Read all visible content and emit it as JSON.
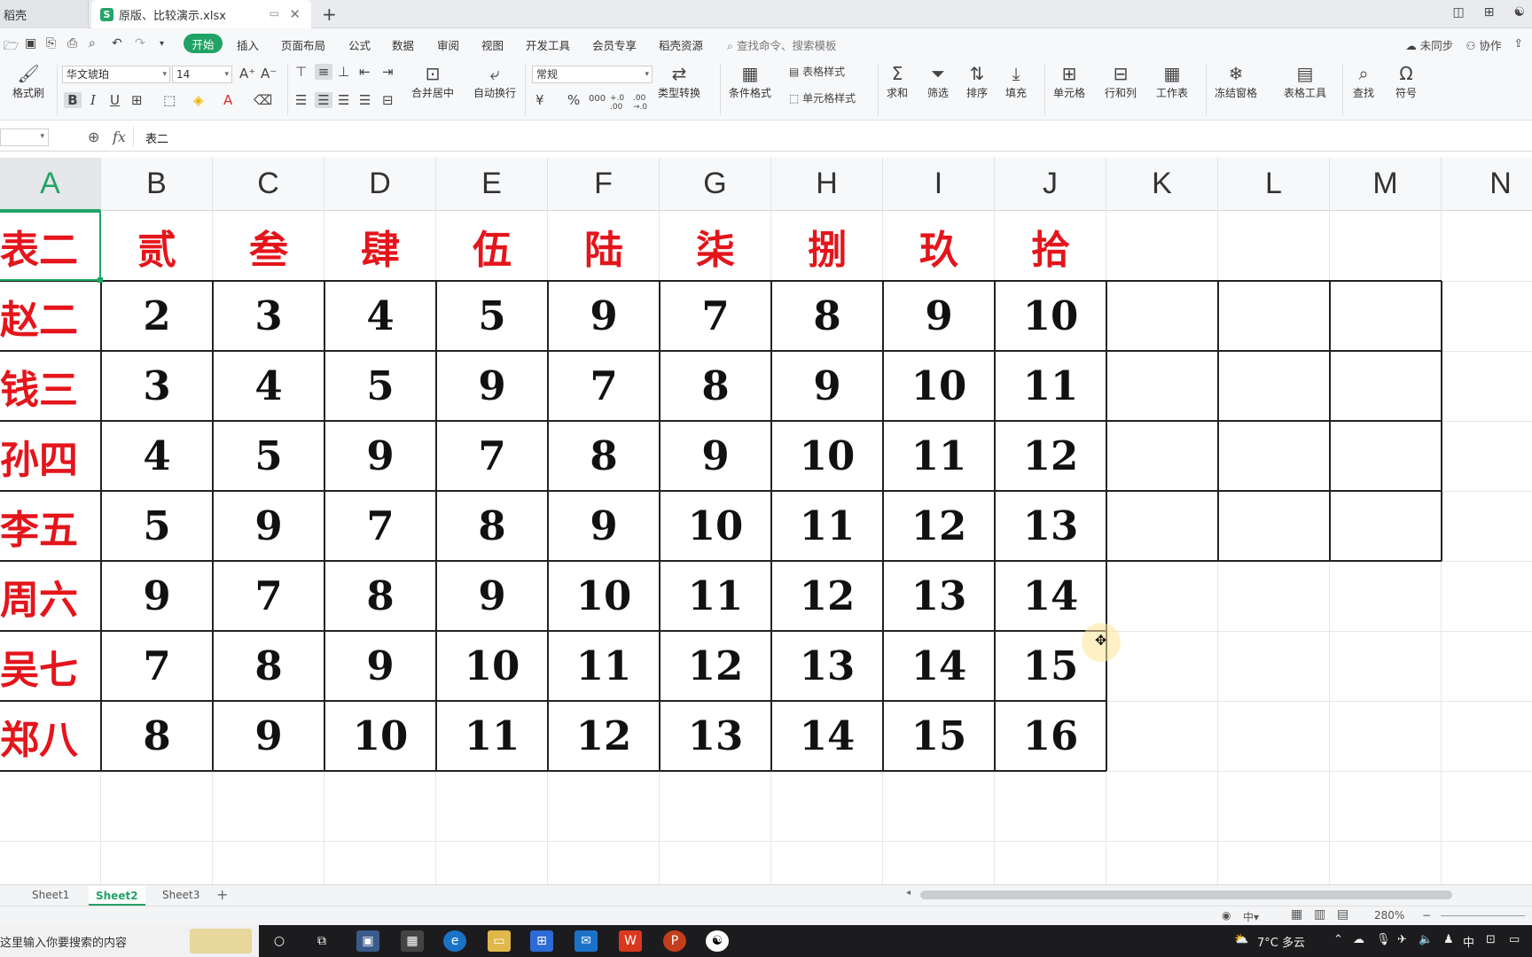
{
  "tabs": {
    "app_tab": "稻壳",
    "doc_tab": "原版、比较演示.xlsx",
    "doc_icon": "S"
  },
  "menu": {
    "start": "开始",
    "items": [
      "插入",
      "页面布局",
      "公式",
      "数据",
      "审阅",
      "视图",
      "开发工具",
      "会员专享",
      "稻壳资源"
    ],
    "search": "查找命令、搜索模板",
    "sync": "未同步",
    "collab": "协作"
  },
  "ribbon": {
    "format_painter": "格式刷",
    "font_name": "华文琥珀",
    "font_size": "14",
    "merge_center": "合并居中",
    "wrap_text": "自动换行",
    "number_format": "常规",
    "type_convert": "类型转换",
    "cond_format": "条件格式",
    "table_style": "表格样式",
    "cell_style": "单元格样式",
    "sum": "求和",
    "filter": "筛选",
    "sort": "排序",
    "fill": "填充",
    "cell": "单元格",
    "row_col": "行和列",
    "worksheet": "工作表",
    "freeze": "冻结窗格",
    "table_tools": "表格工具",
    "find": "查找",
    "symbol": "符号",
    "currency": "¥",
    "percent": "%",
    "thousands": "000",
    "inc_decimal": "+.0 .00",
    "dec_decimal": ".00 →.0"
  },
  "formula_bar": {
    "name_box": "",
    "fx": "fx",
    "content": "表二"
  },
  "columns": [
    "A",
    "B",
    "C",
    "D",
    "E",
    "F",
    "G",
    "H",
    "I",
    "J",
    "K",
    "L",
    "M",
    "N"
  ],
  "sheet": {
    "title": "表二",
    "headers": [
      "贰",
      "叁",
      "肆",
      "伍",
      "陆",
      "柒",
      "捌",
      "玖",
      "拾"
    ],
    "rows": [
      {
        "name": "赵二",
        "values": [
          "2",
          "3",
          "4",
          "5",
          "9",
          "7",
          "8",
          "9",
          "10"
        ]
      },
      {
        "name": "钱三",
        "values": [
          "3",
          "4",
          "5",
          "9",
          "7",
          "8",
          "9",
          "10",
          "11"
        ]
      },
      {
        "name": "孙四",
        "values": [
          "4",
          "5",
          "9",
          "7",
          "8",
          "9",
          "10",
          "11",
          "12"
        ]
      },
      {
        "name": "李五",
        "values": [
          "5",
          "9",
          "7",
          "8",
          "9",
          "10",
          "11",
          "12",
          "13"
        ]
      },
      {
        "name": "周六",
        "values": [
          "9",
          "7",
          "8",
          "9",
          "10",
          "11",
          "12",
          "13",
          "14"
        ]
      },
      {
        "name": "吴七",
        "values": [
          "7",
          "8",
          "9",
          "10",
          "11",
          "12",
          "13",
          "14",
          "15"
        ]
      },
      {
        "name": "郑八",
        "values": [
          "8",
          "9",
          "10",
          "11",
          "12",
          "13",
          "14",
          "15",
          "16"
        ]
      }
    ]
  },
  "sheet_tabs": [
    "Sheet1",
    "Sheet2",
    "Sheet3"
  ],
  "active_sheet": "Sheet2",
  "status": {
    "zoom": "280%"
  },
  "taskbar": {
    "search_placeholder": "这里输入你要搜索的内容",
    "weather": "7°C 多云",
    "ime": "中"
  },
  "colors": {
    "accent": "#21a366",
    "header_red": "#e4151b"
  }
}
